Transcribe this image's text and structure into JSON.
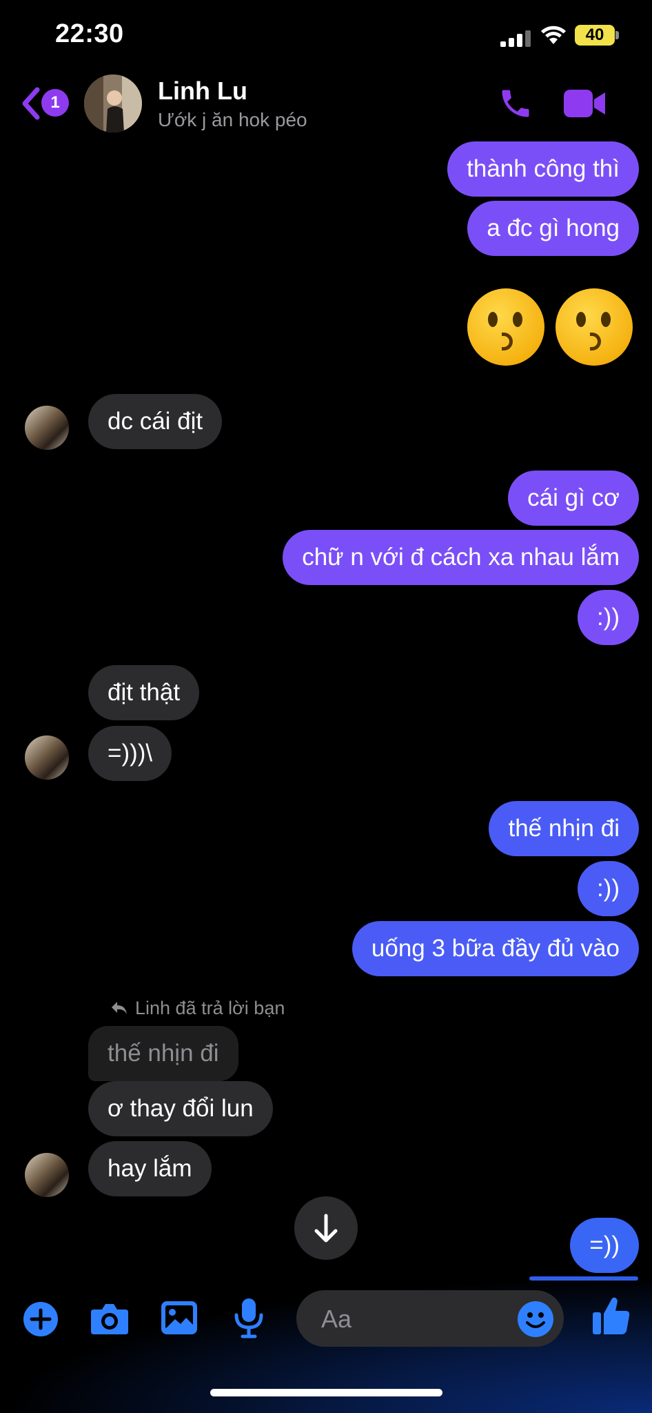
{
  "status_bar": {
    "time": "22:30",
    "battery": "40"
  },
  "header": {
    "unread_count": "1",
    "contact_name": "Linh Lu",
    "contact_status": "Ướk j ăn hok péo"
  },
  "messages": [
    {
      "id": "m1",
      "side": "out",
      "text": "thành công thì"
    },
    {
      "id": "m2",
      "side": "out",
      "text": "a đc gì hong"
    },
    {
      "id": "m3",
      "side": "in",
      "text": "dc cái địt"
    },
    {
      "id": "m4",
      "side": "out",
      "text": "cái gì cơ"
    },
    {
      "id": "m5",
      "side": "out",
      "text": "chữ n với đ cách xa nhau lắm"
    },
    {
      "id": "m6",
      "side": "out",
      "text": ":))"
    },
    {
      "id": "m7",
      "side": "in",
      "text": "địt thật"
    },
    {
      "id": "m8",
      "side": "in",
      "text": "=)))\\"
    },
    {
      "id": "m9",
      "side": "out",
      "text": "thế nhịn đi"
    },
    {
      "id": "m10",
      "side": "out",
      "text": ":))"
    },
    {
      "id": "m11",
      "side": "out",
      "text": "uống 3 bữa đầy đủ vào"
    },
    {
      "id": "m12",
      "side": "in",
      "text": "thế nhịn đi",
      "quoted": true
    },
    {
      "id": "m13",
      "side": "in",
      "text": "ơ thay đổi lun"
    },
    {
      "id": "m14",
      "side": "in",
      "text": "hay lắm"
    },
    {
      "id": "m15",
      "side": "out",
      "text": "=))"
    }
  ],
  "reply_note": "Linh đã trả lời bạn",
  "composer": {
    "placeholder": "Aa"
  },
  "icons": {
    "back": "chevron-left-icon",
    "call": "phone-icon",
    "video": "video-camera-icon",
    "plus": "plus-circle-icon",
    "camera": "camera-icon",
    "gallery": "image-icon",
    "mic": "microphone-icon",
    "emoji": "smiley-icon",
    "like": "thumbs-up-icon",
    "scroll": "arrow-down-icon"
  },
  "colors": {
    "accent_purple": "#8e3bf0",
    "outgoing_purple": "#7b4ff7",
    "outgoing_blue": "#4a5cf5",
    "incoming_gray": "#2c2c2e",
    "icon_blue": "#2f80ff"
  }
}
